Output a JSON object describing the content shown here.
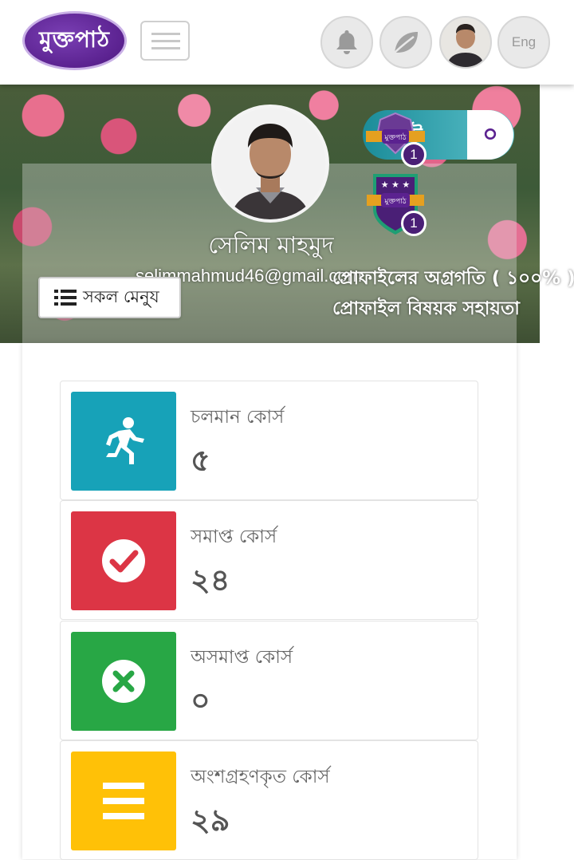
{
  "header": {
    "logo_text": "মুক্তপাঠ",
    "language_label": "Eng"
  },
  "profile": {
    "name": "সেলিম মাহমুদ",
    "email": "selimmahmud46@gmail.com",
    "progress_text": "প্রোফাইলের অগ্রগতি ( ১০০% )",
    "help_text": "প্রোফাইল বিষয়ক সহায়তা",
    "menu_button_label": "সকল মেনু্য"
  },
  "points": {
    "label": "ট",
    "value": "০"
  },
  "badges": [
    {
      "name": "মুক্তপাঠ",
      "count": "1"
    },
    {
      "name": "মুক্তপাঠ",
      "count": "1"
    }
  ],
  "stats": [
    {
      "label": "চলমান কোর্স",
      "value": "৫",
      "color": "#17a2b8",
      "icon": "running-person-icon"
    },
    {
      "label": "সমাপ্ত কোর্স",
      "value": "২৪",
      "color": "#dc3545",
      "icon": "check-circle-icon"
    },
    {
      "label": "অসমাপ্ত কোর্স",
      "value": "০",
      "color": "#28a745",
      "icon": "times-circle-icon"
    },
    {
      "label": "অংশগ্রহণকৃত কোর্স",
      "value": "২৯",
      "color": "#ffc107",
      "icon": "bars-icon"
    }
  ]
}
